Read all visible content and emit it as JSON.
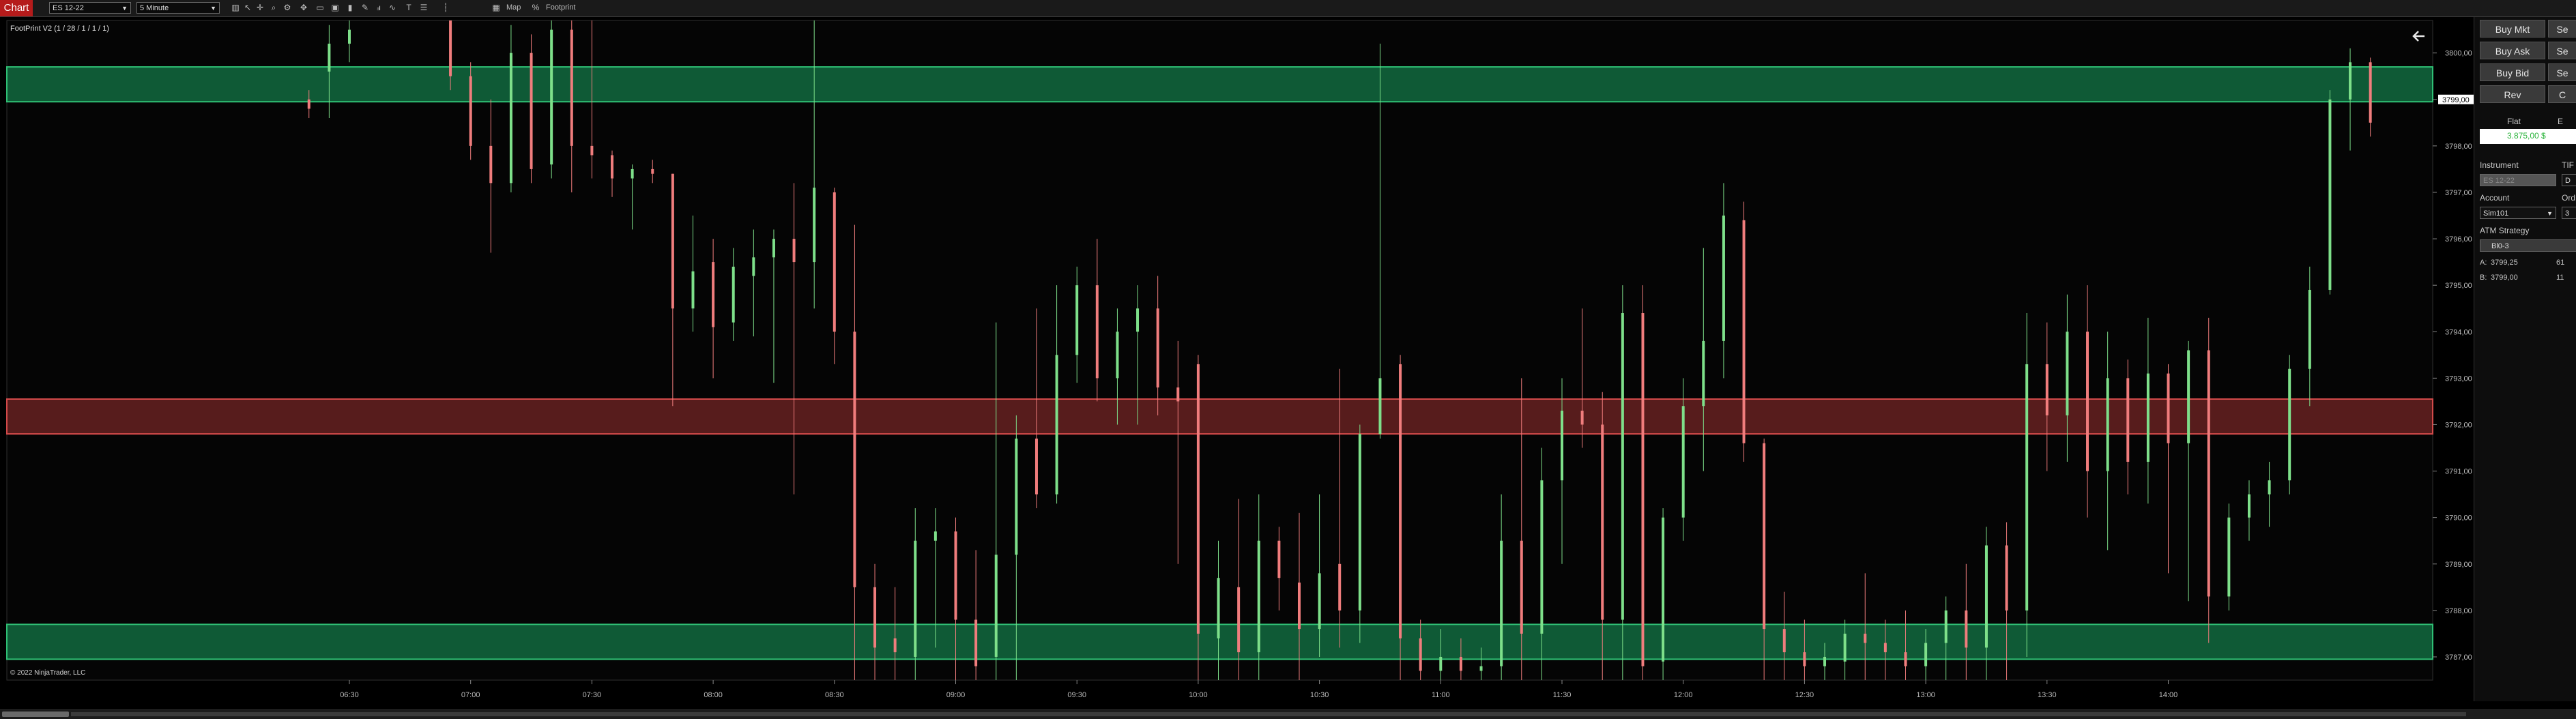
{
  "toolbar": {
    "tab": "Chart",
    "instrument": "ES 12-22",
    "interval": "5 Minute",
    "map_label": "Map",
    "footprint_label": "Footprint"
  },
  "colors": {
    "up": "#7ee08a",
    "down": "#f07d7d",
    "zone_green": "#0f5a36",
    "zone_red": "#571c1c",
    "last_price_bg": "#ffffff",
    "accent": "#b51b1b"
  },
  "chart_data": {
    "type": "candlestick",
    "indicator_label": "FootPrint V2 (1 / 28 / 1 / 1 / 1)",
    "copyright": "© 2022 NinjaTrader, LLC",
    "x_ticks": [
      "06:30",
      "07:00",
      "07:30",
      "08:00",
      "08:30",
      "09:00",
      "09:30",
      "10:00",
      "10:30",
      "11:00",
      "11:30",
      "12:00",
      "12:30",
      "13:00",
      "13:30",
      "14:00"
    ],
    "y_ticks": [
      "3800,00",
      "3799,00",
      "3798,00",
      "3797,00",
      "3796,00",
      "3795,00",
      "3794,00",
      "3793,00",
      "3792,00",
      "3791,00",
      "3790,00",
      "3789,00",
      "3788,00",
      "3787,00"
    ],
    "ylim": [
      3786.5,
      3800.7
    ],
    "last_price": "3799,00",
    "zones": [
      {
        "kind": "support",
        "low": 3798.95,
        "high": 3799.7
      },
      {
        "kind": "resistance",
        "low": 3791.8,
        "high": 3792.55
      },
      {
        "kind": "support",
        "low": 3786.95,
        "high": 3787.7
      }
    ],
    "candles": [
      {
        "time": "06:20",
        "o": 3799.0,
        "h": 3799.2,
        "l": 3798.6,
        "c": 3798.8
      },
      {
        "time": "06:25",
        "o": 3799.6,
        "h": 3800.6,
        "l": 3798.6,
        "c": 3800.2
      },
      {
        "time": "06:30",
        "o": 3800.2,
        "h": 3800.7,
        "l": 3799.8,
        "c": 3800.5
      },
      {
        "time": "06:55",
        "o": 3800.7,
        "h": 3800.7,
        "l": 3799.2,
        "c": 3799.5
      },
      {
        "time": "07:00",
        "o": 3799.5,
        "h": 3799.8,
        "l": 3797.7,
        "c": 3798.0
      },
      {
        "time": "07:05",
        "o": 3798.0,
        "h": 3799.0,
        "l": 3795.7,
        "c": 3797.2
      },
      {
        "time": "07:10",
        "o": 3797.2,
        "h": 3800.6,
        "l": 3797.0,
        "c": 3800.0
      },
      {
        "time": "07:15",
        "o": 3800.0,
        "h": 3800.4,
        "l": 3797.2,
        "c": 3797.5
      },
      {
        "time": "07:20",
        "o": 3797.6,
        "h": 3800.7,
        "l": 3797.3,
        "c": 3800.5
      },
      {
        "time": "07:25",
        "o": 3800.5,
        "h": 3800.7,
        "l": 3797.0,
        "c": 3798.0
      },
      {
        "time": "07:30",
        "o": 3798.0,
        "h": 3800.7,
        "l": 3797.3,
        "c": 3797.8
      },
      {
        "time": "07:35",
        "o": 3797.8,
        "h": 3797.9,
        "l": 3796.9,
        "c": 3797.3
      },
      {
        "time": "07:40",
        "o": 3797.3,
        "h": 3797.6,
        "l": 3796.2,
        "c": 3797.5
      },
      {
        "time": "07:45",
        "o": 3797.5,
        "h": 3797.7,
        "l": 3797.2,
        "c": 3797.4
      },
      {
        "time": "07:50",
        "o": 3797.4,
        "h": 3797.4,
        "l": 3792.4,
        "c": 3794.5
      },
      {
        "time": "07:55",
        "o": 3794.5,
        "h": 3796.5,
        "l": 3794.0,
        "c": 3795.3
      },
      {
        "time": "08:00",
        "o": 3795.5,
        "h": 3796.0,
        "l": 3793.0,
        "c": 3794.1
      },
      {
        "time": "08:05",
        "o": 3794.2,
        "h": 3795.8,
        "l": 3793.8,
        "c": 3795.4
      },
      {
        "time": "08:10",
        "o": 3795.2,
        "h": 3796.2,
        "l": 3793.9,
        "c": 3795.6
      },
      {
        "time": "08:15",
        "o": 3795.6,
        "h": 3796.2,
        "l": 3792.9,
        "c": 3796.0
      },
      {
        "time": "08:20",
        "o": 3796.0,
        "h": 3797.2,
        "l": 3790.5,
        "c": 3795.5
      },
      {
        "time": "08:25",
        "o": 3795.5,
        "h": 3800.7,
        "l": 3794.5,
        "c": 3797.1
      },
      {
        "time": "08:30",
        "o": 3797.0,
        "h": 3797.1,
        "l": 3793.3,
        "c": 3794.0
      },
      {
        "time": "08:35",
        "o": 3794.0,
        "h": 3796.3,
        "l": 3786.5,
        "c": 3788.5
      },
      {
        "time": "08:40",
        "o": 3788.5,
        "h": 3789.0,
        "l": 3786.5,
        "c": 3787.2
      },
      {
        "time": "08:45",
        "o": 3787.4,
        "h": 3788.5,
        "l": 3786.5,
        "c": 3787.1
      },
      {
        "time": "08:50",
        "o": 3787.0,
        "h": 3790.2,
        "l": 3786.5,
        "c": 3789.5
      },
      {
        "time": "08:55",
        "o": 3789.5,
        "h": 3790.2,
        "l": 3787.2,
        "c": 3789.7
      },
      {
        "time": "09:00",
        "o": 3789.7,
        "h": 3790.0,
        "l": 3786.5,
        "c": 3787.8
      },
      {
        "time": "09:05",
        "o": 3787.8,
        "h": 3789.3,
        "l": 3786.5,
        "c": 3786.8
      },
      {
        "time": "09:10",
        "o": 3787.0,
        "h": 3794.2,
        "l": 3786.5,
        "c": 3789.2
      },
      {
        "time": "09:15",
        "o": 3789.2,
        "h": 3792.2,
        "l": 3786.5,
        "c": 3791.7
      },
      {
        "time": "09:20",
        "o": 3791.7,
        "h": 3794.5,
        "l": 3790.2,
        "c": 3790.5
      },
      {
        "time": "09:25",
        "o": 3790.5,
        "h": 3795.0,
        "l": 3790.3,
        "c": 3793.5
      },
      {
        "time": "09:30",
        "o": 3793.5,
        "h": 3795.4,
        "l": 3792.9,
        "c": 3795.0
      },
      {
        "time": "09:35",
        "o": 3795.0,
        "h": 3796.0,
        "l": 3792.5,
        "c": 3793.0
      },
      {
        "time": "09:40",
        "o": 3793.0,
        "h": 3794.5,
        "l": 3792.0,
        "c": 3794.0
      },
      {
        "time": "09:45",
        "o": 3794.0,
        "h": 3795.0,
        "l": 3792.0,
        "c": 3794.5
      },
      {
        "time": "09:50",
        "o": 3794.5,
        "h": 3795.2,
        "l": 3792.2,
        "c": 3792.8
      },
      {
        "time": "09:55",
        "o": 3792.8,
        "h": 3793.8,
        "l": 3789.0,
        "c": 3792.5
      },
      {
        "time": "10:00",
        "o": 3793.3,
        "h": 3793.5,
        "l": 3786.5,
        "c": 3787.5
      },
      {
        "time": "10:05",
        "o": 3787.4,
        "h": 3789.5,
        "l": 3786.5,
        "c": 3788.7
      },
      {
        "time": "10:10",
        "o": 3788.5,
        "h": 3790.4,
        "l": 3786.5,
        "c": 3787.1
      },
      {
        "time": "10:15",
        "o": 3787.1,
        "h": 3790.5,
        "l": 3786.5,
        "c": 3789.5
      },
      {
        "time": "10:20",
        "o": 3789.5,
        "h": 3789.8,
        "l": 3788.0,
        "c": 3788.7
      },
      {
        "time": "10:25",
        "o": 3788.6,
        "h": 3790.1,
        "l": 3786.5,
        "c": 3787.6
      },
      {
        "time": "10:30",
        "o": 3787.6,
        "h": 3790.5,
        "l": 3787.0,
        "c": 3788.8
      },
      {
        "time": "10:35",
        "o": 3789.0,
        "h": 3793.2,
        "l": 3787.2,
        "c": 3788.0
      },
      {
        "time": "10:40",
        "o": 3788.0,
        "h": 3792.0,
        "l": 3787.3,
        "c": 3791.8
      },
      {
        "time": "10:45",
        "o": 3791.8,
        "h": 3800.2,
        "l": 3791.7,
        "c": 3793.0
      },
      {
        "time": "10:50",
        "o": 3793.3,
        "h": 3793.5,
        "l": 3786.5,
        "c": 3787.4
      },
      {
        "time": "10:55",
        "o": 3787.4,
        "h": 3787.8,
        "l": 3786.5,
        "c": 3786.7
      },
      {
        "time": "11:00",
        "o": 3786.7,
        "h": 3787.6,
        "l": 3786.5,
        "c": 3787.0
      },
      {
        "time": "11:05",
        "o": 3787.0,
        "h": 3787.4,
        "l": 3786.5,
        "c": 3786.7
      },
      {
        "time": "11:10",
        "o": 3786.7,
        "h": 3787.2,
        "l": 3786.5,
        "c": 3786.8
      },
      {
        "time": "11:15",
        "o": 3786.8,
        "h": 3790.5,
        "l": 3786.5,
        "c": 3789.5
      },
      {
        "time": "11:20",
        "o": 3789.5,
        "h": 3793.0,
        "l": 3786.5,
        "c": 3787.5
      },
      {
        "time": "11:25",
        "o": 3787.5,
        "h": 3791.5,
        "l": 3786.5,
        "c": 3790.8
      },
      {
        "time": "11:30",
        "o": 3790.8,
        "h": 3793.0,
        "l": 3789.0,
        "c": 3792.3
      },
      {
        "time": "11:35",
        "o": 3792.3,
        "h": 3794.5,
        "l": 3791.5,
        "c": 3792.0
      },
      {
        "time": "11:40",
        "o": 3792.0,
        "h": 3792.7,
        "l": 3786.5,
        "c": 3787.8
      },
      {
        "time": "11:45",
        "o": 3787.8,
        "h": 3795.0,
        "l": 3786.5,
        "c": 3794.4
      },
      {
        "time": "11:50",
        "o": 3794.4,
        "h": 3795.0,
        "l": 3786.5,
        "c": 3786.8
      },
      {
        "time": "11:55",
        "o": 3786.9,
        "h": 3790.2,
        "l": 3786.5,
        "c": 3790.0
      },
      {
        "time": "12:00",
        "o": 3790.0,
        "h": 3793.0,
        "l": 3789.5,
        "c": 3792.4
      },
      {
        "time": "12:05",
        "o": 3792.4,
        "h": 3795.8,
        "l": 3791.0,
        "c": 3793.8
      },
      {
        "time": "12:10",
        "o": 3793.8,
        "h": 3797.2,
        "l": 3793.0,
        "c": 3796.5
      },
      {
        "time": "12:15",
        "o": 3796.4,
        "h": 3796.8,
        "l": 3791.2,
        "c": 3791.6
      },
      {
        "time": "12:20",
        "o": 3791.6,
        "h": 3791.7,
        "l": 3786.5,
        "c": 3787.6
      },
      {
        "time": "12:25",
        "o": 3787.6,
        "h": 3788.4,
        "l": 3786.5,
        "c": 3787.1
      },
      {
        "time": "12:30",
        "o": 3787.1,
        "h": 3787.8,
        "l": 3786.5,
        "c": 3786.8
      },
      {
        "time": "12:35",
        "o": 3786.8,
        "h": 3787.3,
        "l": 3786.5,
        "c": 3787.0
      },
      {
        "time": "12:40",
        "o": 3786.9,
        "h": 3787.8,
        "l": 3786.5,
        "c": 3787.5
      },
      {
        "time": "12:45",
        "o": 3787.5,
        "h": 3788.8,
        "l": 3786.5,
        "c": 3787.3
      },
      {
        "time": "12:50",
        "o": 3787.3,
        "h": 3787.8,
        "l": 3786.5,
        "c": 3787.1
      },
      {
        "time": "12:55",
        "o": 3787.1,
        "h": 3788.0,
        "l": 3786.5,
        "c": 3786.8
      },
      {
        "time": "13:00",
        "o": 3786.8,
        "h": 3787.6,
        "l": 3786.5,
        "c": 3787.3
      },
      {
        "time": "13:05",
        "o": 3787.3,
        "h": 3788.3,
        "l": 3786.5,
        "c": 3788.0
      },
      {
        "time": "13:10",
        "o": 3788.0,
        "h": 3789.0,
        "l": 3786.5,
        "c": 3787.2
      },
      {
        "time": "13:15",
        "o": 3787.2,
        "h": 3789.8,
        "l": 3786.5,
        "c": 3789.4
      },
      {
        "time": "13:20",
        "o": 3789.4,
        "h": 3789.9,
        "l": 3786.5,
        "c": 3788.0
      },
      {
        "time": "13:25",
        "o": 3788.0,
        "h": 3794.4,
        "l": 3787.0,
        "c": 3793.3
      },
      {
        "time": "13:30",
        "o": 3793.3,
        "h": 3794.2,
        "l": 3791.0,
        "c": 3792.2
      },
      {
        "time": "13:35",
        "o": 3792.2,
        "h": 3794.8,
        "l": 3791.2,
        "c": 3794.0
      },
      {
        "time": "13:40",
        "o": 3794.0,
        "h": 3795.0,
        "l": 3790.0,
        "c": 3791.0
      },
      {
        "time": "13:45",
        "o": 3791.0,
        "h": 3794.0,
        "l": 3789.3,
        "c": 3793.0
      },
      {
        "time": "13:50",
        "o": 3793.0,
        "h": 3793.4,
        "l": 3790.5,
        "c": 3791.2
      },
      {
        "time": "13:55",
        "o": 3791.2,
        "h": 3794.3,
        "l": 3790.3,
        "c": 3793.1
      },
      {
        "time": "14:00",
        "o": 3793.1,
        "h": 3793.3,
        "l": 3788.8,
        "c": 3791.6
      },
      {
        "time": "14:05",
        "o": 3791.6,
        "h": 3793.8,
        "l": 3788.2,
        "c": 3793.6
      },
      {
        "time": "14:10",
        "o": 3793.6,
        "h": 3794.3,
        "l": 3787.3,
        "c": 3788.3
      },
      {
        "time": "14:15",
        "o": 3788.3,
        "h": 3790.3,
        "l": 3788.0,
        "c": 3790.0
      },
      {
        "time": "14:20",
        "o": 3790.0,
        "h": 3790.8,
        "l": 3789.5,
        "c": 3790.5
      },
      {
        "time": "14:25",
        "o": 3790.5,
        "h": 3791.2,
        "l": 3789.8,
        "c": 3790.8
      },
      {
        "time": "14:30",
        "o": 3790.8,
        "h": 3793.5,
        "l": 3790.5,
        "c": 3793.2
      },
      {
        "time": "14:35",
        "o": 3793.2,
        "h": 3795.4,
        "l": 3792.4,
        "c": 3794.9
      },
      {
        "time": "14:40",
        "o": 3794.9,
        "h": 3799.2,
        "l": 3794.8,
        "c": 3799.0
      },
      {
        "time": "14:45",
        "o": 3799.0,
        "h": 3800.1,
        "l": 3797.9,
        "c": 3799.8
      },
      {
        "time": "14:50",
        "o": 3799.8,
        "h": 3799.9,
        "l": 3798.2,
        "c": 3798.5
      }
    ]
  },
  "panel": {
    "buy_mkt": "Buy Mkt",
    "sell_mkt": "Se",
    "buy_ask": "Buy Ask",
    "sell_ask": "Se",
    "buy_bid": "Buy Bid",
    "sell_bid": "Se",
    "rev": "Rev",
    "close": "C",
    "flat": "Flat",
    "flat_right": "E",
    "pnl": "3.875,00 $",
    "instrument_label": "Instrument",
    "tif_label": "TIF",
    "instrument_value": "ES 12-22",
    "tif_value": "D",
    "account_label": "Account",
    "order_label": "Ord",
    "account_value": "Sim101",
    "order_value": "3",
    "atm_label": "ATM Strategy",
    "atm_value": "Bl0-3",
    "ask_label": "A:",
    "ask_price": "3799,25",
    "ask_size": "61",
    "bid_label": "B:",
    "bid_price": "3799,00",
    "bid_size": "11"
  }
}
